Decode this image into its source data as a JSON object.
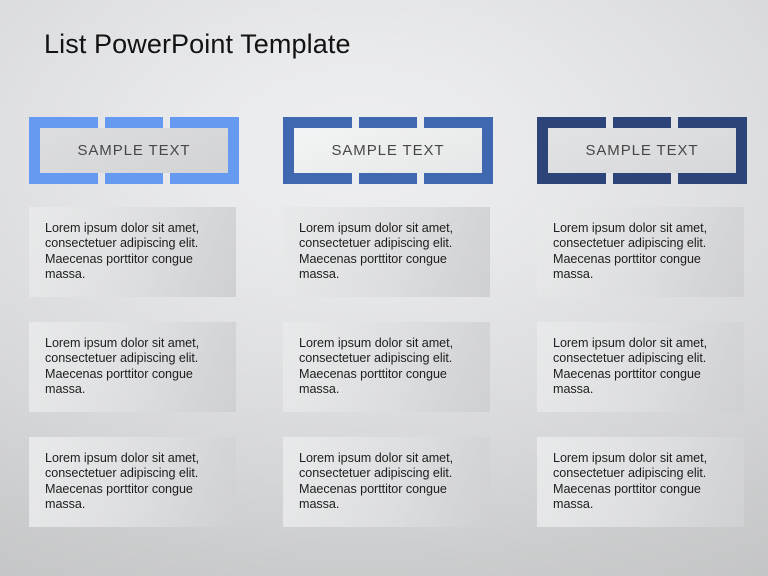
{
  "slide": {
    "title": "List PowerPoint Template",
    "background_color": "#d6d7d9",
    "body_text": "Lorem ipsum dolor sit amet, consectetuer adipiscing elit. Maecenas porttitor congue massa."
  },
  "columns": [
    {
      "id": "column-1",
      "header_label": "SAMPLE TEXT",
      "accent_color": "#6699f0",
      "cards": [
        {
          "text": "Lorem ipsum dolor sit amet, consectetuer adipiscing elit. Maecenas porttitor congue massa."
        },
        {
          "text": "Lorem ipsum dolor sit amet, consectetuer adipiscing elit. Maecenas porttitor congue massa."
        },
        {
          "text": "Lorem ipsum dolor sit amet, consectetuer adipiscing elit. Maecenas porttitor congue massa."
        }
      ]
    },
    {
      "id": "column-2",
      "header_label": "SAMPLE TEXT",
      "accent_color": "#4068b0",
      "cards": [
        {
          "text": "Lorem ipsum dolor sit amet, consectetuer adipiscing elit. Maecenas porttitor congue massa."
        },
        {
          "text": "Lorem ipsum dolor sit amet, consectetuer adipiscing elit. Maecenas porttitor congue massa."
        },
        {
          "text": "Lorem ipsum dolor sit amet, consectetuer adipiscing elit. Maecenas porttitor congue massa."
        }
      ]
    },
    {
      "id": "column-3",
      "header_label": "SAMPLE TEXT",
      "accent_color": "#2c4478",
      "cards": [
        {
          "text": "Lorem ipsum dolor sit amet, consectetuer adipiscing elit. Maecenas porttitor congue massa."
        },
        {
          "text": "Lorem ipsum dolor sit amet, consectetuer adipiscing elit. Maecenas porttitor congue massa."
        },
        {
          "text": "Lorem ipsum dolor sit amet, consectetuer adipiscing elit. Maecenas porttitor congue massa."
        }
      ]
    }
  ]
}
